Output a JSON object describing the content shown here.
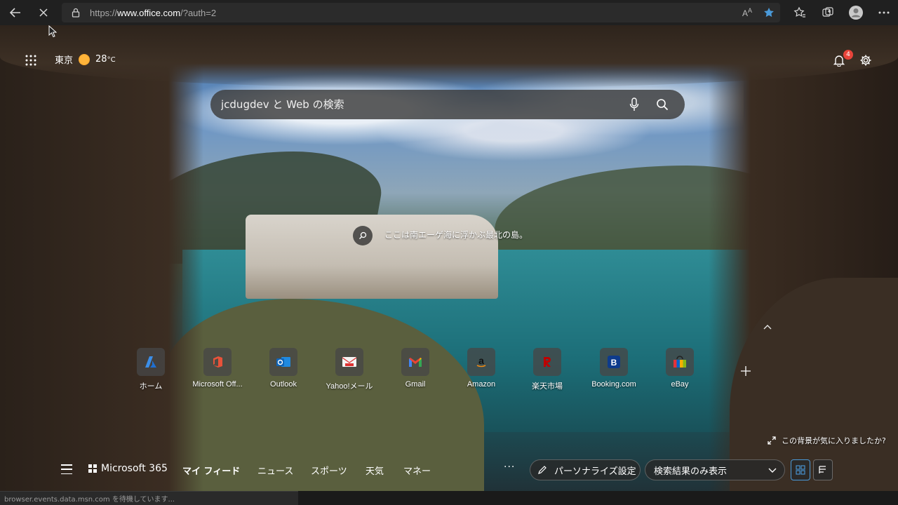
{
  "browser": {
    "url_prefix": "https://",
    "url_domain": "www.office.com",
    "url_path": "/?auth=2",
    "status_text": "browser.events.data.msn.com を待機しています..."
  },
  "weather": {
    "city": "東京",
    "temp": "28",
    "unit": "°C"
  },
  "notifications": {
    "count": "4"
  },
  "search": {
    "placeholder": "jcdugdev と Web の検索"
  },
  "image_info": {
    "caption": "ここは南エーゲ海に浮かぶ最北の島。"
  },
  "quick_links": [
    {
      "label": "ホーム",
      "icon": "azure-icon"
    },
    {
      "label": "Microsoft Off...",
      "icon": "office-icon"
    },
    {
      "label": "Outlook",
      "icon": "outlook-icon"
    },
    {
      "label": "Yahoo!メール",
      "icon": "yahoo-mail-icon"
    },
    {
      "label": "Gmail",
      "icon": "gmail-icon"
    },
    {
      "label": "Amazon",
      "icon": "amazon-icon"
    },
    {
      "label": "楽天市場",
      "icon": "rakuten-icon"
    },
    {
      "label": "Booking.com",
      "icon": "booking-icon"
    },
    {
      "label": "eBay",
      "icon": "ebay-icon"
    }
  ],
  "background_prompt": "この背景が気に入りましたか?",
  "bottom_nav": {
    "ms365": "Microsoft 365",
    "items": [
      "マイ フィード",
      "ニュース",
      "スポーツ",
      "天気",
      "マネー"
    ],
    "more": "···",
    "personalize": "パーソナライズ設定",
    "filter_selected": "検索結果のみ表示"
  },
  "colors": {
    "accent": "#4a9ad9",
    "badge": "#e8443a",
    "favorite_star": "#4a9ad9"
  }
}
